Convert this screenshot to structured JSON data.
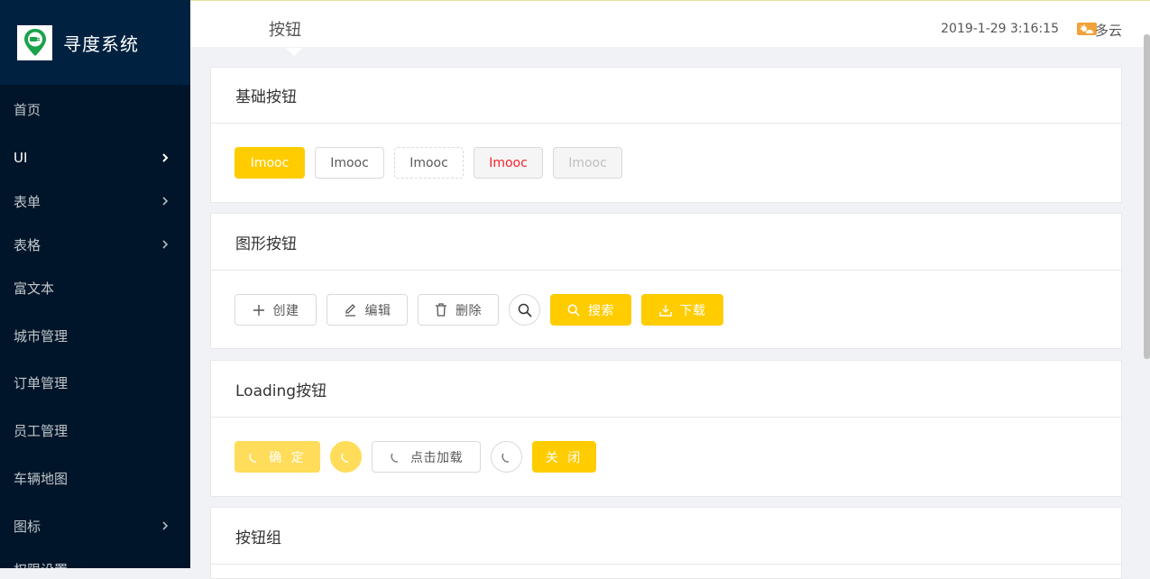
{
  "app": {
    "title": "寻度系统"
  },
  "colors": {
    "accent": "#ffcc00",
    "sidebar": "#001529",
    "logo_bg": "#002140"
  },
  "sidebar": {
    "items": [
      {
        "label": "首页",
        "has_arrow": false
      },
      {
        "label": "UI",
        "has_arrow": true
      },
      {
        "label": "表单",
        "has_arrow": true
      },
      {
        "label": "表格",
        "has_arrow": true
      },
      {
        "label": "富文本",
        "has_arrow": false
      },
      {
        "label": "城市管理",
        "has_arrow": false
      },
      {
        "label": "订单管理",
        "has_arrow": false
      },
      {
        "label": "员工管理",
        "has_arrow": false
      },
      {
        "label": "车辆地图",
        "has_arrow": false
      },
      {
        "label": "图标",
        "has_arrow": true
      },
      {
        "label": "权限设置",
        "has_arrow": false
      }
    ]
  },
  "header": {
    "breadcrumb": "按钮",
    "datetime": "2019-1-29 3:16:15",
    "weather": "多云",
    "weather_icon": "cloud-sun-icon"
  },
  "cards": {
    "basic": {
      "title": "基础按钮",
      "buttons": [
        "Imooc",
        "Imooc",
        "Imooc",
        "Imooc",
        "Imooc"
      ]
    },
    "icon": {
      "title": "图形按钮",
      "create": "创建",
      "edit": "编辑",
      "delete": "删除",
      "search": "搜索",
      "download": "下载"
    },
    "loading": {
      "title": "Loading按钮",
      "confirm": "确 定",
      "click_load": "点击加载",
      "close": "关 闭"
    },
    "group": {
      "title": "按钮组"
    }
  }
}
